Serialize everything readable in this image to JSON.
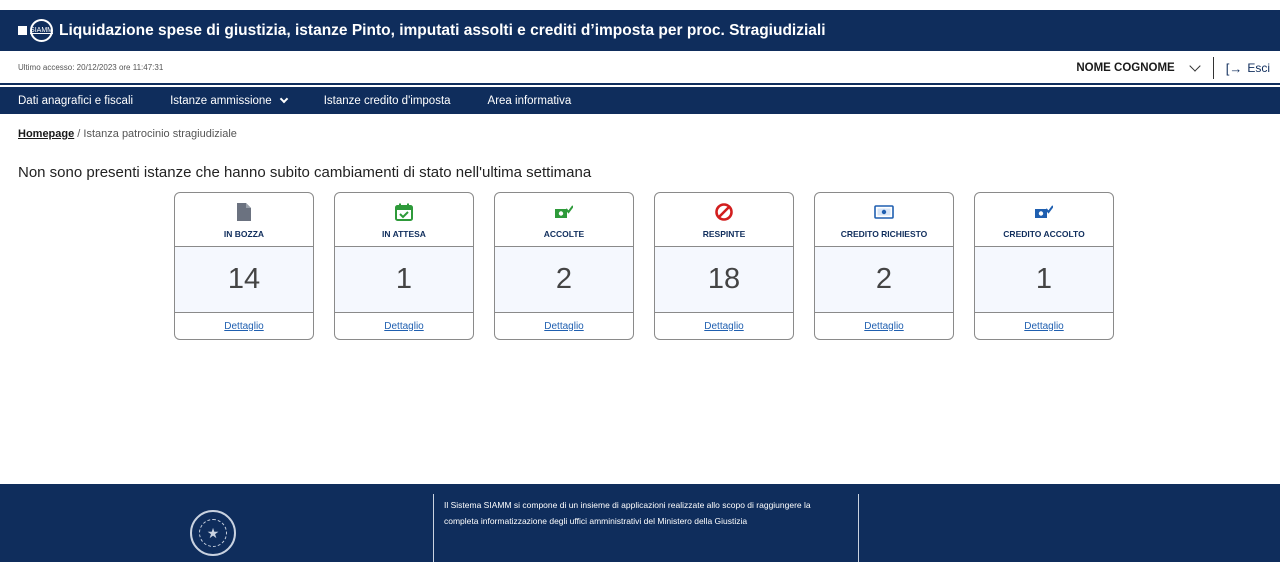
{
  "header": {
    "logo_text": "SIAMM",
    "title": "Liquidazione spese di giustizia, istanze Pinto, imputati assolti e crediti d’imposta per proc. Stragiudiziali"
  },
  "userbar": {
    "last_access": "Ultimo accesso: 20/12/2023 ore 11:47:31",
    "user_name": "NOME COGNOME",
    "logout_label": "Esci"
  },
  "nav": {
    "items": [
      {
        "label": "Dati anagrafici e fiscali"
      },
      {
        "label": "Istanze ammissione"
      },
      {
        "label": "Istanze credito d'imposta"
      },
      {
        "label": "Area informativa"
      }
    ]
  },
  "breadcrumb": {
    "home": "Homepage",
    "separator": " / ",
    "current": "Istanza patrocinio stragiudiziale"
  },
  "notice": "Non sono presenti istanze che hanno subito cambiamenti di stato nell'ultima settimana",
  "cards": [
    {
      "label": "IN BOZZA",
      "count": "14",
      "link": "Dettaglio",
      "icon": "document-icon",
      "color": "#6b7280"
    },
    {
      "label": "IN ATTESA",
      "count": "1",
      "link": "Dettaglio",
      "icon": "calendar-check-icon",
      "color": "#2e9a3a"
    },
    {
      "label": "ACCOLTE",
      "count": "2",
      "link": "Dettaglio",
      "icon": "money-check-icon",
      "color": "#2e9a3a"
    },
    {
      "label": "RESPINTE",
      "count": "18",
      "link": "Dettaglio",
      "icon": "ban-icon",
      "color": "#d21e1e"
    },
    {
      "label": "CREDITO RICHIESTO",
      "count": "2",
      "link": "Dettaglio",
      "icon": "banknote-icon",
      "color": "#1f5fb0"
    },
    {
      "label": "CREDITO ACCOLTO",
      "count": "1",
      "link": "Dettaglio",
      "icon": "money-check-icon",
      "color": "#1f5fb0"
    }
  ],
  "footer": {
    "text": "Il Sistema SIAMM si compone di un insieme di applicazioni realizzate allo scopo di raggiungere la completa informatizzazione degli uffici amministrativi del Ministero della Giustizia"
  },
  "colors": {
    "brand_navy": "#0f2d5c",
    "link_blue": "#1f5fb0",
    "count_bg": "#f5f8fe"
  }
}
